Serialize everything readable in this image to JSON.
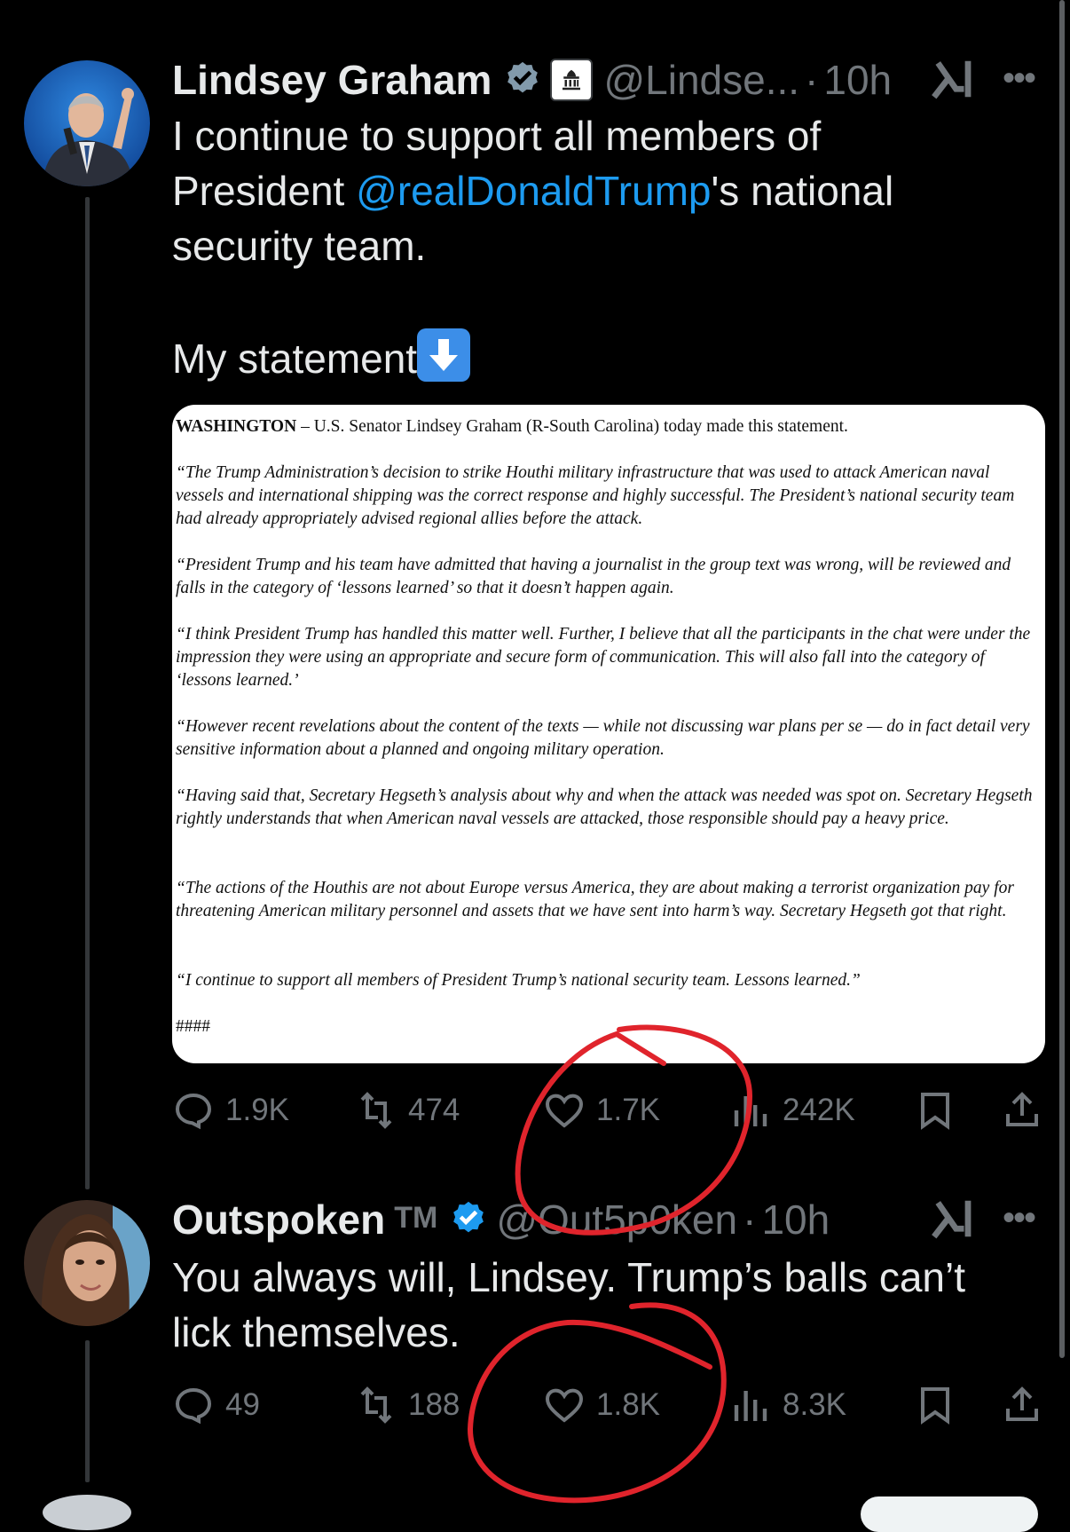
{
  "tweets": [
    {
      "author": "Lindsey Graham",
      "handle": "@Lindse...",
      "time": "10h",
      "separator": "·",
      "text_lines": [
        "I continue to support all members of"
      ],
      "text_prefix": "President ",
      "mention": "@realDonaldTrump",
      "text_suffix": "'s national",
      "text_line3": "security team.",
      "text_statement": "My statement",
      "document": {
        "lead_bold": "WASHINGTON",
        "lead_rest": " – U.S. Senator Lindsey Graham (R-South Carolina) today made this statement.",
        "paragraphs": [
          "“The Trump Administration’s decision to strike Houthi military infrastructure that was used to attack American naval vessels and international shipping was the correct response and highly successful. The President’s national security team had already appropriately advised regional allies before the attack.",
          "“President Trump and his team have admitted that having a journalist in the group text was wrong, will be reviewed and falls in the category of ‘lessons learned’ so that it doesn’t happen again.",
          "“I think President Trump has handled this matter well. Further, I believe that all the participants in the chat were under the impression they were using an appropriate and secure form of communication. This will also fall into the category of ‘lessons learned.’",
          "“However recent revelations about the content of the texts — while not discussing war plans per se — do in fact detail very sensitive information about a planned and ongoing military operation.",
          "“Having said that, Secretary Hegseth’s analysis about why and when the attack was needed was spot on. Secretary Hegseth rightly understands that when American naval vessels are attacked, those responsible should pay a heavy price.",
          "“The actions of the Houthis are not about Europe versus America, they are about making a terrorist organization pay for threatening American military personnel and assets that we have sent into harm’s way. Secretary Hegseth got that right.",
          "“I continue to support all members of President Trump’s national security team. Lessons learned.”",
          "####"
        ]
      },
      "stats": {
        "replies": "1.9K",
        "reposts": "474",
        "likes": "1.7K",
        "views": "242K"
      }
    },
    {
      "author": "Outspoken",
      "author_badge": "TM",
      "handle": "@Out5p0ken",
      "time": "10h",
      "separator": "·",
      "text_lines": [
        "You always will, Lindsey. Trump’s balls can’t",
        "lick themselves."
      ],
      "stats": {
        "replies": "49",
        "reposts": "188",
        "likes": "1.8K",
        "views": "8.3K"
      }
    }
  ],
  "icons": [
    "verified-badge-icon",
    "government-building-icon",
    "grok-icon",
    "more-icon",
    "reply-icon",
    "repost-icon",
    "like-icon",
    "views-icon",
    "bookmark-icon",
    "share-icon",
    "down-arrow-emoji"
  ],
  "colors": {
    "background": "#000000",
    "text": "#e7e9ea",
    "muted": "#71767b",
    "accent": "#1d9bf0",
    "annotation": "#e0242c"
  }
}
